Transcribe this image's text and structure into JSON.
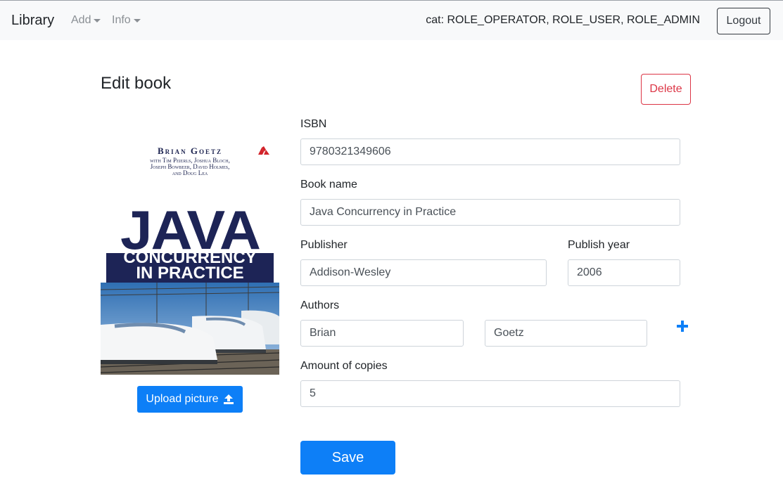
{
  "navbar": {
    "brand": "Library",
    "menu": [
      {
        "label": "Add",
        "icon": "caret-down-icon"
      },
      {
        "label": "Info",
        "icon": "caret-down-icon"
      }
    ],
    "user_roles": "cat: ROLE_OPERATOR, ROLE_USER, ROLE_ADMIN",
    "logout_label": "Logout"
  },
  "page": {
    "title": "Edit book",
    "delete_label": "Delete"
  },
  "cover": {
    "author": "Brian Goetz",
    "coauthors_line1": "with Tim Peierls, Joshua Bloch,",
    "coauthors_line2": "Joseph Bowbeer, David Holmes,",
    "coauthors_line3": "and Doug Lea",
    "title_main": "JAVA",
    "title_sub_line1": "CONCURRENCY",
    "title_sub_line2": "IN PRACTICE",
    "upload_label": "Upload picture",
    "upload_icon": "upload-icon"
  },
  "form": {
    "isbn": {
      "label": "ISBN",
      "value": "9780321349606"
    },
    "book_name": {
      "label": "Book name",
      "value": "Java Concurrency in Practice"
    },
    "publisher": {
      "label": "Publisher",
      "value": "Addison-Wesley"
    },
    "publish_year": {
      "label": "Publish year",
      "value": "2006"
    },
    "authors": {
      "label": "Authors",
      "first_name": "Brian",
      "last_name": "Goetz",
      "add_icon": "plus-icon"
    },
    "copies": {
      "label": "Amount of copies",
      "value": "5"
    },
    "save_label": "Save"
  },
  "colors": {
    "primary": "#0d7ff7",
    "danger": "#dc3545",
    "navbar_bg": "#f8f9fa",
    "cover_navy": "#1d2456"
  }
}
